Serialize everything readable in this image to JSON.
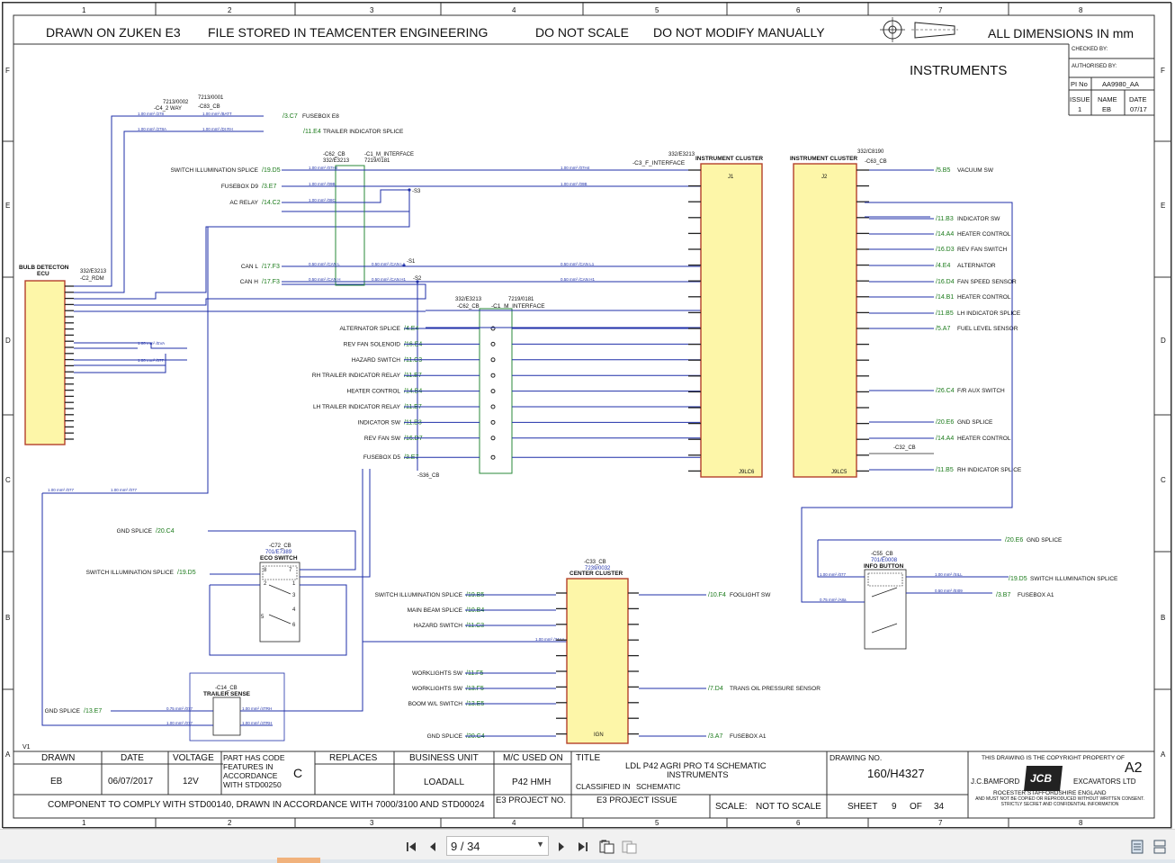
{
  "header": {
    "drawn_on": "DRAWN ON ZUKEN E3",
    "file_stored": "FILE STORED IN TEAMCENTER ENGINEERING",
    "do_not_scale": "DO NOT SCALE",
    "do_not_modify": "DO NOT MODIFY MANUALLY",
    "dimensions": "ALL DIMENSIONS IN mm",
    "zone_columns": [
      "1",
      "2",
      "3",
      "4",
      "5",
      "6",
      "7",
      "8"
    ],
    "zone_rows": [
      "F",
      "E",
      "D",
      "C",
      "B",
      "A"
    ]
  },
  "title_right": "INSTRUMENTS",
  "revision_block": {
    "checked_by": "CHECKED BY:",
    "authorised_by": "AUTHORISED BY:",
    "pi_no_label": "PI No",
    "pi_no_value": "AA9980_AA",
    "issue_label": "ISSUE",
    "name_label": "NAME",
    "date_label": "DATE",
    "issue_value": "1",
    "name_value": "EB",
    "date_value": "07/17"
  },
  "components": {
    "ecu_label_1": "BULB DETECTON",
    "ecu_label_2": "ECU",
    "ecu_part": "332/E3213",
    "ecu_conn": "-C2_RDM",
    "c4_part": "7213/0002",
    "c4_name": "-C4_2 WAY",
    "c83_part": "7213/0001",
    "c83_name": "-C83_CB",
    "c62_top": "-C62_CB",
    "c62_top_part": "332/E3213",
    "c1_top": "-C1_M_INTERFACE",
    "c1_top_part": "7219/0181",
    "c62_mid": "-C62_CB",
    "c62_mid_part": "332/E3213",
    "c1_mid": "-C1_M_INTERFACE",
    "c1_mid_part": "7219/0181",
    "c3_name": "-C3_F_INTERFACE",
    "c3_part": "332/E3213",
    "ic1_title": "INSTRUMENT CLUSTER",
    "ic1_j": "J1",
    "ic1_foot": "J9LC6",
    "ic2_title": "INSTRUMENT CLUSTER",
    "ic2_j": "J2",
    "ic2_foot": "J9LC5",
    "c63_name": "-C63_CB",
    "c63_part": "332/C8190",
    "c32_name": "-C32_CB",
    "c72_name": "-C72_CB",
    "c72_part": "701/E7389",
    "c72_title": "ECO SWITCH",
    "c14_name": "-C14_CB",
    "c14_title": "TRAILER SENSE",
    "c33_name": "-C33_CB",
    "c33_part": "7239/0032",
    "c33_title": "CENTER CLUSTER",
    "c33_ign": "IGN",
    "c55_name": "-C55_CB",
    "c55_part": "701/E0008",
    "c55_title": "INFO BUTTON",
    "s36": "-S36_CB",
    "s1": "-S1",
    "s2": "-S2",
    "s3": "-S3",
    "v1": "V1"
  },
  "signals_left_top": [
    {
      "ref": "/3.C7",
      "name": "FUSEBOX E8"
    },
    {
      "ref": "/11.E4",
      "name": "TRAILER INDICATOR SPLICE"
    },
    {
      "ref": "/19.D5",
      "name": "SWITCH ILLUMINATION SPLICE"
    },
    {
      "ref": "/3.E7",
      "name": "FUSEBOX D9"
    },
    {
      "ref": "/14.C2",
      "name": "AC RELAY"
    },
    {
      "ref": "/17.F3",
      "name": "CAN L"
    },
    {
      "ref": "/17.F3",
      "name": "CAN H"
    }
  ],
  "signals_left_mid": [
    {
      "ref": "/4.E4",
      "name": "ALTERNATOR SPLICE"
    },
    {
      "ref": "/16.E4",
      "name": "REV FAN SOLENOID"
    },
    {
      "ref": "/11.C3",
      "name": "HAZARD SWITCH"
    },
    {
      "ref": "/11.E7",
      "name": "RH TRAILER INDICATOR RELAY"
    },
    {
      "ref": "/14.B4",
      "name": "HEATER CONTROL"
    },
    {
      "ref": "/11.E7",
      "name": "LH TRAILER INDICATOR RELAY"
    },
    {
      "ref": "/11.B3",
      "name": "INDICATOR SW"
    },
    {
      "ref": "/16.D7",
      "name": "REV FAN SW"
    },
    {
      "ref": "/3.E7",
      "name": "FUSEBOX D5"
    }
  ],
  "signals_right_j2": [
    {
      "ref": "/5.B5",
      "name": "VACUUM SW"
    },
    {
      "ref": "/11.B3",
      "name": "INDICATOR SW"
    },
    {
      "ref": "/14.A4",
      "name": "HEATER CONTROL"
    },
    {
      "ref": "/16.D3",
      "name": "REV FAN SWITCH"
    },
    {
      "ref": "/4.E4",
      "name": "ALTERNATOR"
    },
    {
      "ref": "/16.D4",
      "name": "FAN SPEED SENSOR"
    },
    {
      "ref": "/14.B1",
      "name": "HEATER CONTROL"
    },
    {
      "ref": "/11.B5",
      "name": "LH INDICATOR SPLICE"
    },
    {
      "ref": "/5.A7",
      "name": "FUEL LEVEL SENSOR"
    },
    {
      "ref": "/26.C4",
      "name": "F/R AUX SWITCH"
    },
    {
      "ref": "/20.E6",
      "name": "GND SPLICE"
    },
    {
      "ref": "/14.A4",
      "name": "HEATER CONTROL"
    },
    {
      "ref": "/11.B5",
      "name": "RH INDICATOR SPLICE"
    }
  ],
  "signals_lower": {
    "gnd_splice_1": {
      "ref": "/20.C4",
      "name": "GND SPLICE"
    },
    "switch_illum_eco": {
      "ref": "/19.D5",
      "name": "SWITCH ILLUMINATION SPLICE"
    },
    "gnd_splice_2": {
      "ref": "/13.E7",
      "name": "GND SPLICE"
    },
    "gnd_splice_info": {
      "ref": "/20.E6",
      "name": "GND SPLICE"
    },
    "switch_illum_info": {
      "ref": "/19.D5",
      "name": "SWITCH ILLUMINATION SPLICE"
    },
    "fusebox_a1_info": {
      "ref": "/3.B7",
      "name": "FUSEBOX A1"
    }
  },
  "signals_center": [
    {
      "ref": "/19.B5",
      "name": "SWITCH ILLUMINATION SPLICE"
    },
    {
      "ref": "/10.B4",
      "name": "MAIN BEAM SPLICE"
    },
    {
      "ref": "/11.C3",
      "name": "HAZARD SWITCH"
    },
    {
      "ref": "/11.F5",
      "name": "WORKLIGHTS SW"
    },
    {
      "ref": "/13.F5",
      "name": "WORKLIGHTS SW"
    },
    {
      "ref": "/13.E5",
      "name": "BOOM W/L SWITCH"
    },
    {
      "ref": "/20.C4",
      "name": "GND SPLICE"
    }
  ],
  "signals_center_right": [
    {
      "ref": "/10.F4",
      "name": "FOGLIGHT SW"
    },
    {
      "ref": "/7.D4",
      "name": "TRANS OIL PRESSURE SENSOR"
    },
    {
      "ref": "/3.A7",
      "name": "FUSEBOX A1"
    }
  ],
  "title_block": {
    "drawn_label": "DRAWN",
    "drawn_value": "EB",
    "date_label": "DATE",
    "date_value": "06/07/2017",
    "voltage_label": "VOLTAGE",
    "voltage_value": "12V",
    "code_note": "PART HAS CODE FEATURES IN ACCORDANCE WITH STD00250",
    "code_letter": "C",
    "replaces_label": "REPLACES",
    "business_unit_label": "BUSINESS UNIT",
    "business_unit_value": "LOADALL",
    "mc_used_label": "M/C USED ON",
    "mc_used_value": "P42 HMH",
    "title_label": "TITLE",
    "title_line1": "LDL P42 AGRI PRO T4 SCHEMATIC",
    "title_line2": "INSTRUMENTS",
    "classified_label": "CLASSIFIED IN",
    "classified_value": "SCHEMATIC",
    "drawing_no_label": "DRAWING NO.",
    "drawing_no_value": "160/H4327",
    "comply_note": "COMPONENT TO COMPLY WITH STD00140, DRAWN IN ACCORDANCE WITH 7000/3100 AND STD00024",
    "e3_project_no": "E3 PROJECT NO.",
    "e3_project_issue": "E3 PROJECT ISSUE",
    "scale_label": "SCALE:",
    "scale_value": "NOT TO SCALE",
    "sheet_label": "SHEET",
    "sheet_value": "9",
    "of_label": "OF",
    "of_value": "34",
    "copyright": "THIS DRAWING IS THE COPYRIGHT PROPERTY OF",
    "company_left": "J.C.BAMFORD",
    "company_right": "EXCAVATORS LTD",
    "location": "ROCESTER     STAFFORDSHIRE     ENGLAND",
    "confidential": "AND MUST NOT BE COPIED OR REPRODUCED WITHOUT WRITTEN CONSENT. STRICTLY SECRET AND CONFIDENTIAL INFORMATION",
    "sheet_size": "A2",
    "logo": "JCB"
  },
  "viewer": {
    "page_indicator": "9 / 34"
  }
}
